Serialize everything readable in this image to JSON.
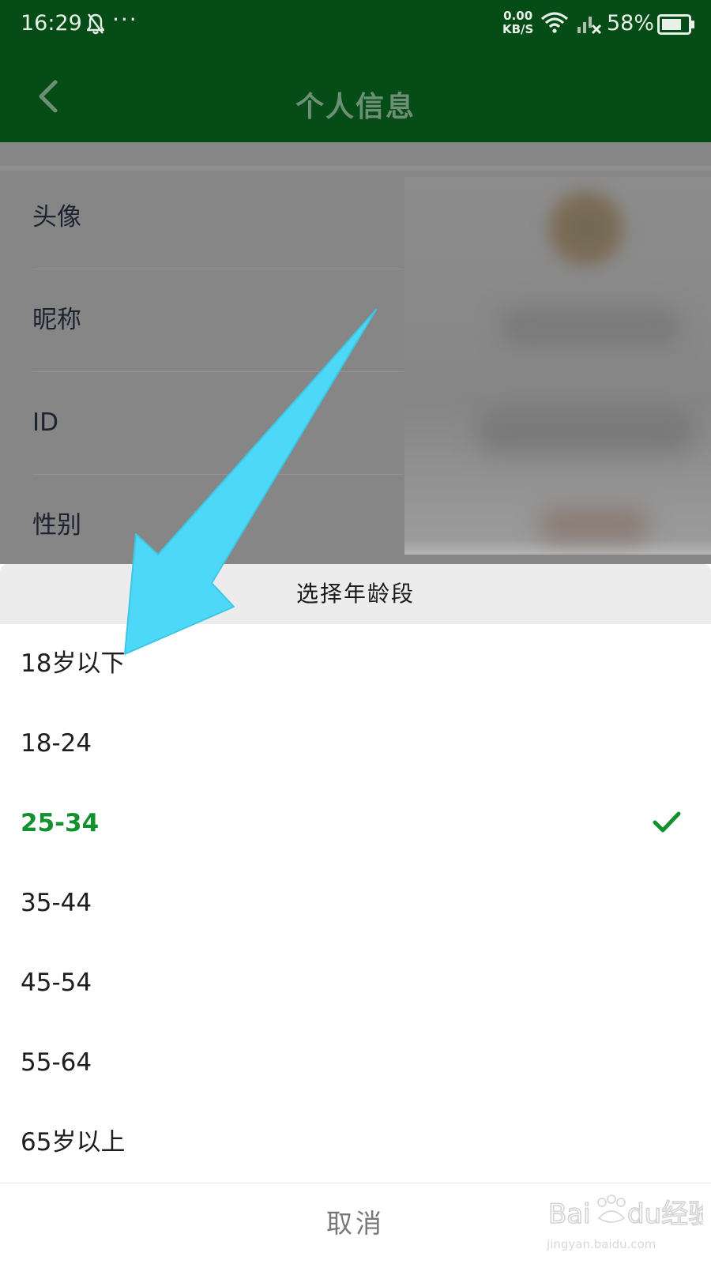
{
  "status_bar": {
    "time": "16:29",
    "speed_value": "0.00",
    "speed_unit": "KB/S",
    "battery": "58%"
  },
  "app_bar": {
    "title": "个人信息",
    "back_icon": "chevron-left-icon"
  },
  "profile": {
    "rows": [
      {
        "label": "头像"
      },
      {
        "label": "昵称"
      },
      {
        "label": "ID"
      },
      {
        "label": "性别"
      }
    ]
  },
  "picker": {
    "title": "选择年龄段",
    "options": [
      {
        "label": "18岁以下"
      },
      {
        "label": "18-24"
      },
      {
        "label": "25-34",
        "selected": true
      },
      {
        "label": "35-44"
      },
      {
        "label": "45-54"
      },
      {
        "label": "55-64"
      },
      {
        "label": "65岁以上"
      }
    ],
    "cancel_label": "取消"
  },
  "watermark": {
    "logo_text": "Baidu经验",
    "url": "jingyan.baidu.com"
  },
  "colors": {
    "app_bar": "#054c16",
    "selected": "#14912f",
    "annotation_arrow": "#4cd8f6",
    "overlay": "#868686"
  }
}
